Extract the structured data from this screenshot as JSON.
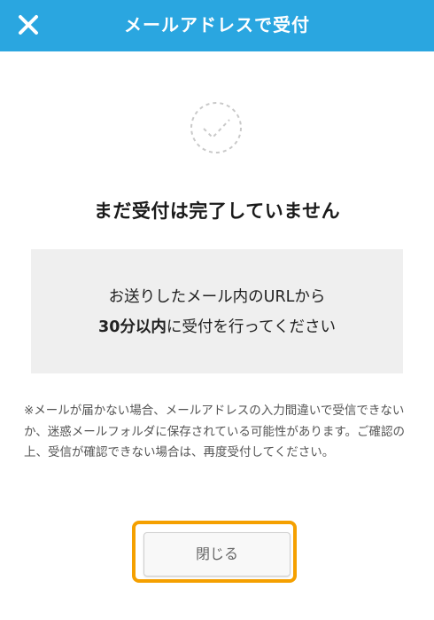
{
  "header": {
    "title": "メールアドレスで受付",
    "close_icon": "close-icon",
    "background_color": "#2aa6e0"
  },
  "status": {
    "icon": "dashed-check-circle-icon",
    "heading": "まだ受付は完了していません"
  },
  "message": {
    "line1": "お送りしたメール内のURLから",
    "line2_bold": "30分以内",
    "line2_rest": "に受付を行ってください"
  },
  "note": {
    "text": "※メールが届かない場合、メールアドレスの入力間違いで受信できないか、迷惑メールフォルダに保存されている可能性があります。ご確認の上、受信が確認できない場合は、再度受付してください。"
  },
  "actions": {
    "close_label": "閉じる",
    "highlight_color": "#f5a000"
  }
}
